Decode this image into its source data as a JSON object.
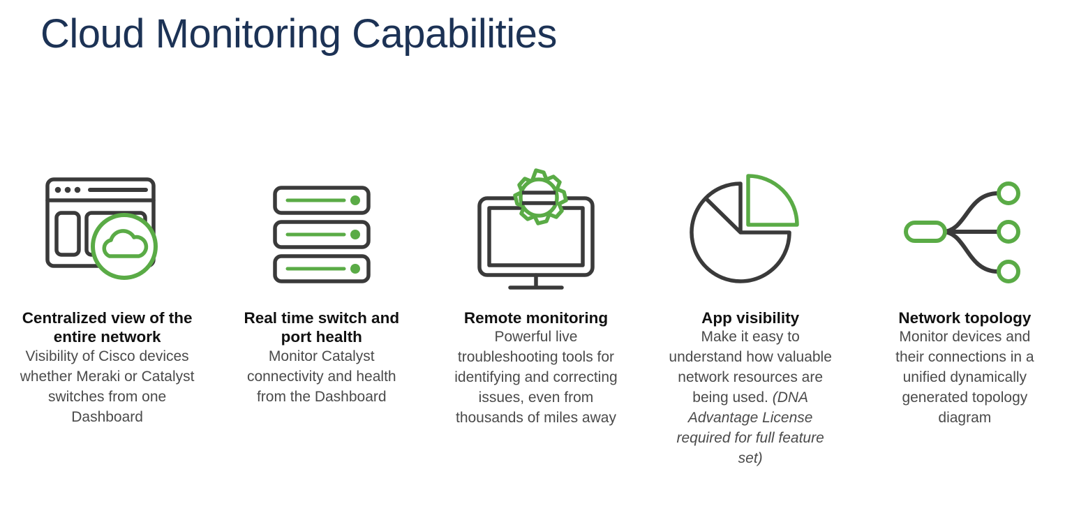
{
  "slide": {
    "title": "Cloud Monitoring Capabilities",
    "title_color": "#1c3255",
    "background_color": "#ffffff",
    "accent_green": "#5aab46",
    "icon_dark": "#3a3a3a",
    "heading_color": "#101010",
    "body_color": "#4a4a4a"
  },
  "columns": [
    {
      "icon_name": "browser-window-cloud-icon",
      "heading": "Centralized view of the entire network",
      "body": "Visibility of Cisco devices whether Meraki or Catalyst switches from one Dashboard",
      "body_italic": ""
    },
    {
      "icon_name": "server-stack-icon",
      "heading": "Real time switch and port health",
      "body": "Monitor Catalyst connectivity and health from the Dashboard",
      "body_italic": ""
    },
    {
      "icon_name": "monitor-gear-icon",
      "heading": "Remote monitoring",
      "body": "Powerful live troubleshooting tools for identifying and correcting issues, even from thousands of miles away",
      "body_italic": ""
    },
    {
      "icon_name": "pie-chart-icon",
      "heading": "App visibility",
      "body": "Make it easy to understand how valuable network resources are being used. ",
      "body_italic": "(DNA Advantage License required for full feature set)"
    },
    {
      "icon_name": "network-topology-icon",
      "heading": "Network topology",
      "body": "Monitor devices and their connections in a unified dynamically generated topology diagram",
      "body_italic": ""
    }
  ]
}
